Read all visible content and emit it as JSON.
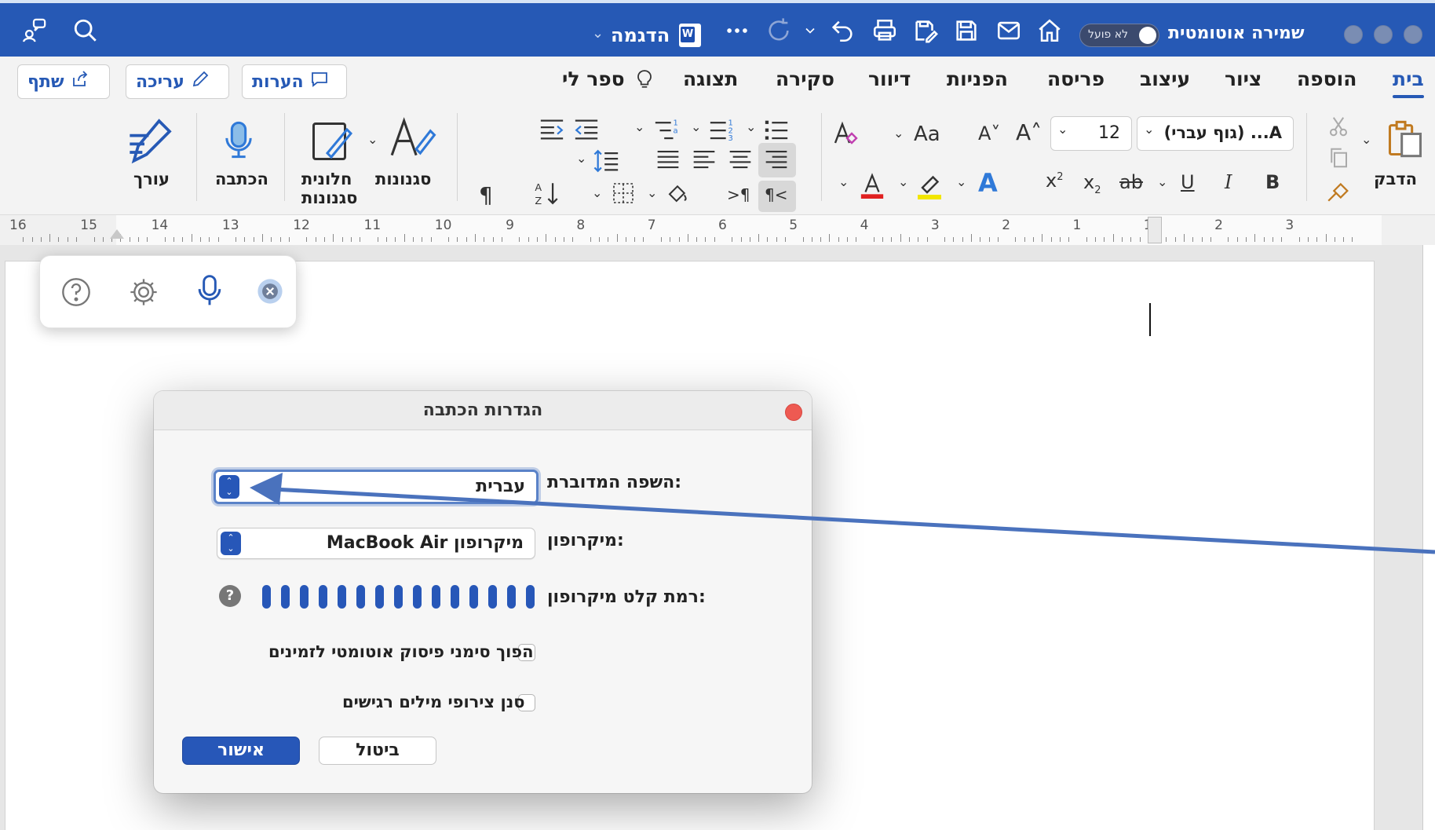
{
  "app": {
    "autosave_label": "שמירה אוטומטית",
    "autosave_state": "לא פועל",
    "doc_title": "הדגמה"
  },
  "tabs": [
    {
      "label": "בית",
      "active": true
    },
    {
      "label": "הוספה"
    },
    {
      "label": "ציור"
    },
    {
      "label": "עיצוב"
    },
    {
      "label": "פריסה"
    },
    {
      "label": "הפניות"
    },
    {
      "label": "דיוור"
    },
    {
      "label": "סקירה"
    },
    {
      "label": "תצוגה"
    },
    {
      "label": "ספר לי"
    }
  ],
  "tab_buttons": {
    "comments": "הערות",
    "edit": "עריכה",
    "share": "שתף"
  },
  "ribbon": {
    "paste": "הדבק",
    "font_name": "(גוף עברי) ...A",
    "font_size": "12",
    "font_case": "Aa",
    "styles": "סגנונות",
    "styles_pane_line1": "חלונית",
    "styles_pane_line2": "סגנונות",
    "dictate": "הכתבה",
    "editor": "עורך"
  },
  "ruler": {
    "numbers": [
      "16",
      "15",
      "14",
      "13",
      "12",
      "11",
      "10",
      "9",
      "8",
      "7",
      "6",
      "5",
      "4",
      "3",
      "2",
      "1",
      "1",
      "2",
      "3"
    ]
  },
  "dialog": {
    "title": "הגדרות הכתבה",
    "language_label": "השפה המדוברת:",
    "language_value": "עברית",
    "mic_label": "מיקרופון:",
    "mic_value": "MacBook Air מיקרופון",
    "level_label": "רמת קלט מיקרופון:",
    "level_bars": 15,
    "help_symbol": "?",
    "auto_punct_label": "הפוך סימני פיסוק אוטומטי לזמינים",
    "filter_label": "סנן צירופי מילים רגישים",
    "ok": "אישור",
    "cancel": "ביטול"
  },
  "colors": {
    "accent": "#2659b5",
    "button_blue": "#2757b8",
    "font_color_red": "#e02020",
    "highlight_yellow": "#f2e600"
  }
}
